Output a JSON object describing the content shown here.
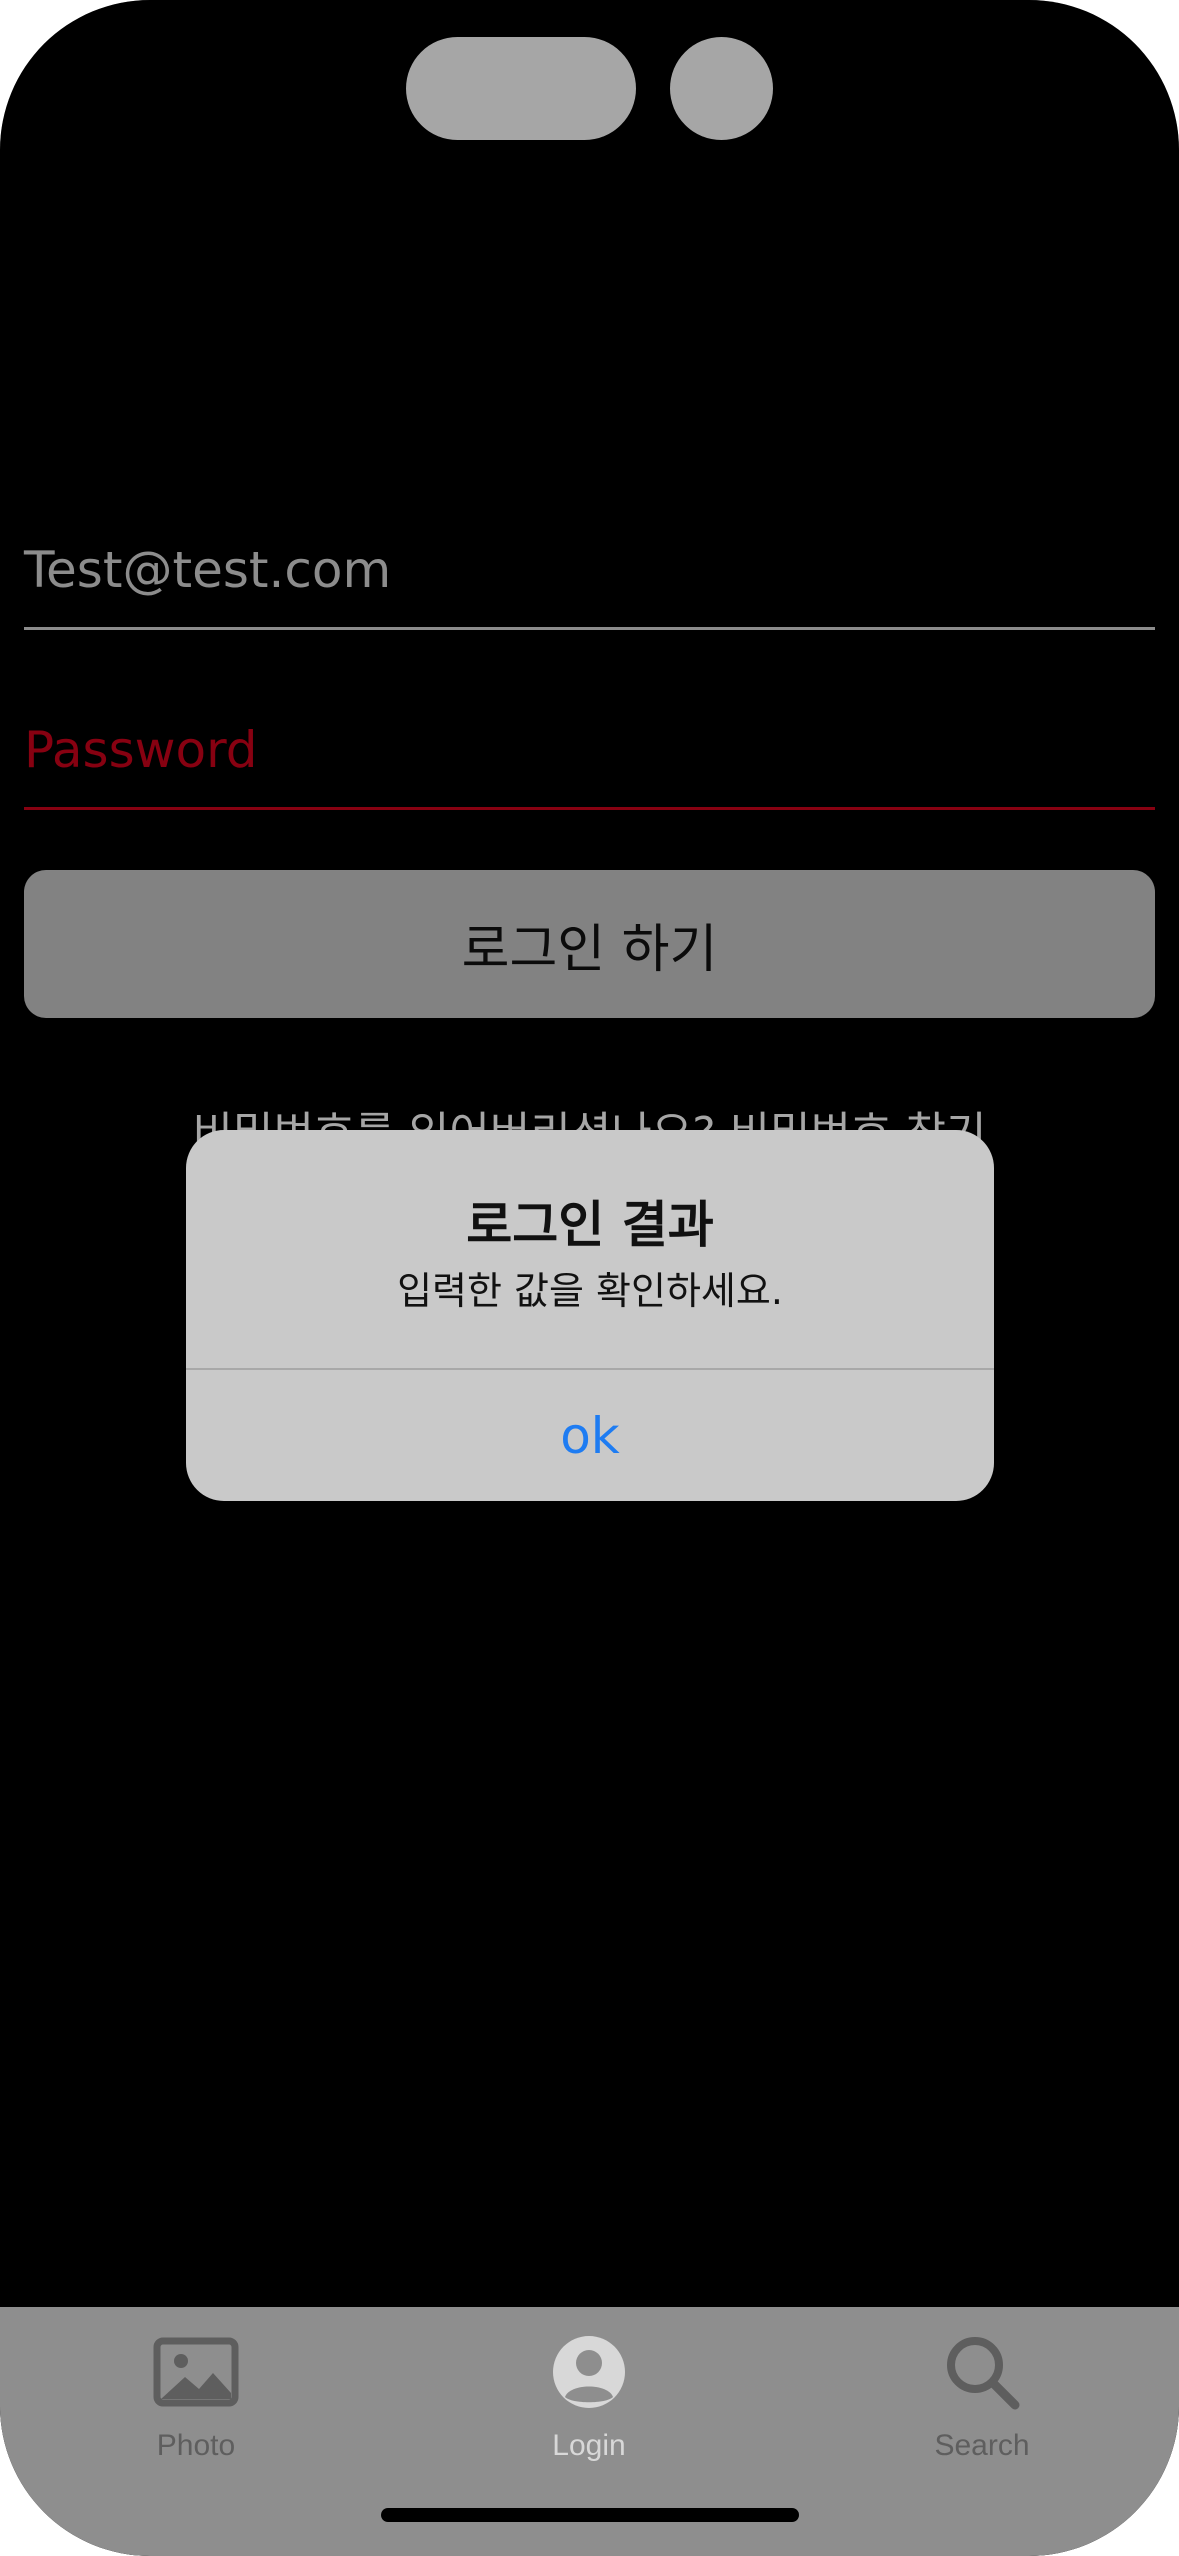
{
  "login_form": {
    "email_value": "Test@test.com",
    "password_placeholder": "Password",
    "login_button_label": "로그인 하기",
    "forgot_password_link": "비밀번호를 잊어버리셨나요? 비밀번호 찾기"
  },
  "alert": {
    "title": "로그인 결과",
    "message": "입력한 값을 확인하세요.",
    "ok_label": "ok"
  },
  "tabbar": {
    "tabs": [
      {
        "label": "Photo",
        "icon": "photo-icon",
        "active": false
      },
      {
        "label": "Login",
        "icon": "person-circle-icon",
        "active": true
      },
      {
        "label": "Search",
        "icon": "search-icon",
        "active": false
      }
    ]
  },
  "colors": {
    "background": "#000000",
    "error_red": "#d0021b",
    "alert_button_blue": "#1e7cf2",
    "tabbar_background": "#8e8e8e",
    "tab_active": "#d8d8d8",
    "tab_inactive": "#5e5e5e"
  }
}
